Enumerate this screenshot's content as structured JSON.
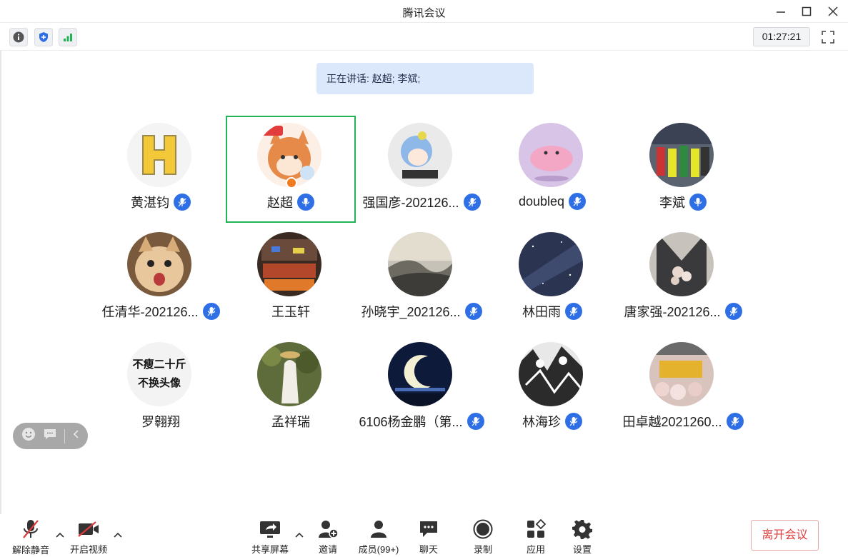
{
  "window": {
    "title": "腾讯会议"
  },
  "top_toolbar": {
    "timer": "01:27:21"
  },
  "speaking_banner": "正在讲话: 赵超; 李斌;",
  "participants": [
    {
      "name": "黄湛钧",
      "mic": true,
      "active": false
    },
    {
      "name": "赵超",
      "mic": true,
      "active": true,
      "host": true
    },
    {
      "name": "强国彦-202126...",
      "mic": true,
      "active": false
    },
    {
      "name": "doubleq",
      "mic": true,
      "active": false
    },
    {
      "name": "李斌",
      "mic": true,
      "active": false
    },
    {
      "name": "任清华-202126...",
      "mic": true,
      "active": false
    },
    {
      "name": "王玉轩",
      "mic": false,
      "active": false
    },
    {
      "name": "孙晓宇_202126...",
      "mic": true,
      "active": false
    },
    {
      "name": "林田雨",
      "mic": true,
      "active": false
    },
    {
      "name": "唐家强-202126...",
      "mic": true,
      "active": false
    },
    {
      "name": "罗翱翔",
      "mic": false,
      "active": false,
      "avatar_text": [
        "不瘦二十斤",
        "不换头像"
      ]
    },
    {
      "name": "孟祥瑞",
      "mic": false,
      "active": false
    },
    {
      "name": "6106杨金鹏（第...",
      "mic": true,
      "active": false
    },
    {
      "name": "林海珍",
      "mic": true,
      "active": false
    },
    {
      "name": "田卓越2021260...",
      "mic": true,
      "active": false
    }
  ],
  "bottom_bar": {
    "unmute": "解除静音",
    "start_video": "开启视频",
    "share_screen": "共享屏幕",
    "invite": "邀请",
    "members": "成员(99+)",
    "chat": "聊天",
    "record": "录制",
    "apps": "应用",
    "settings": "设置",
    "leave": "离开会议"
  },
  "colors": {
    "accent": "#2f6fe6",
    "active_border": "#22b357",
    "leave_text": "#e03a3a",
    "banner_bg": "#dbe8fb"
  }
}
